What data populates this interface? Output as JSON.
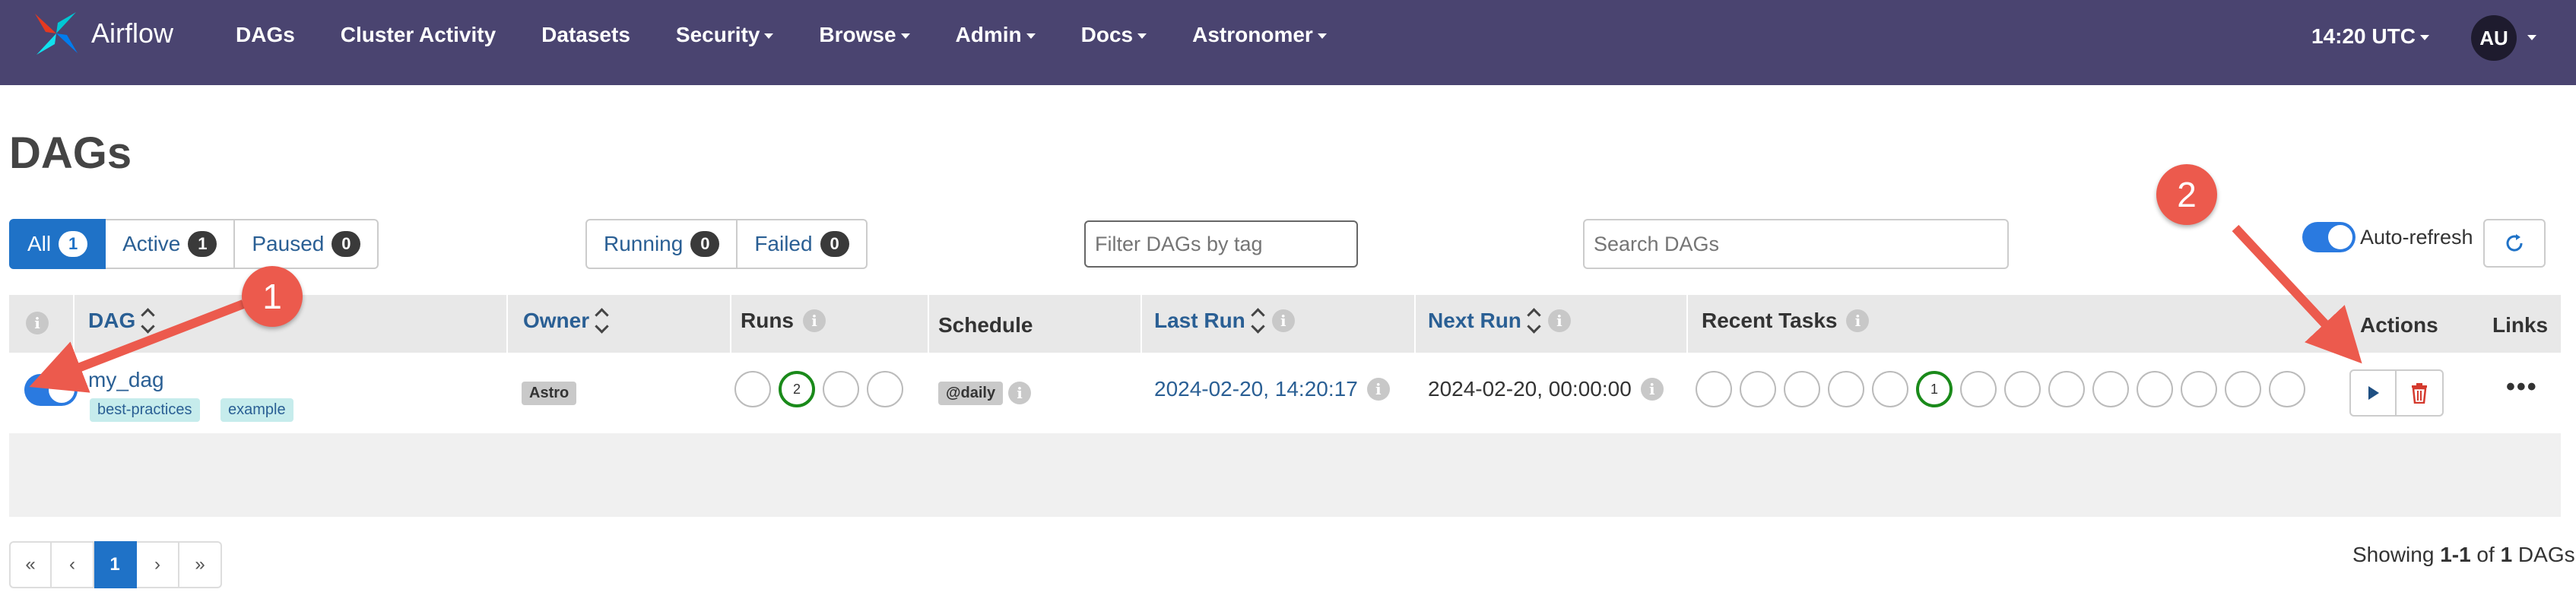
{
  "navbar": {
    "brand": "Airflow",
    "items": [
      {
        "label": "DAGs",
        "dropdown": false
      },
      {
        "label": "Cluster Activity",
        "dropdown": false
      },
      {
        "label": "Datasets",
        "dropdown": false
      },
      {
        "label": "Security",
        "dropdown": true
      },
      {
        "label": "Browse",
        "dropdown": true
      },
      {
        "label": "Admin",
        "dropdown": true
      },
      {
        "label": "Docs",
        "dropdown": true
      },
      {
        "label": "Astronomer",
        "dropdown": true
      }
    ],
    "time": "14:20 UTC",
    "user_initials": "AU"
  },
  "page": {
    "title": "DAGs"
  },
  "filters": {
    "status": [
      {
        "label": "All",
        "count": "1",
        "active": true
      },
      {
        "label": "Active",
        "count": "1",
        "active": false
      },
      {
        "label": "Paused",
        "count": "0",
        "active": false
      }
    ],
    "run_state": [
      {
        "label": "Running",
        "count": "0"
      },
      {
        "label": "Failed",
        "count": "0"
      }
    ],
    "tag_placeholder": "Filter DAGs by tag",
    "search_placeholder": "Search DAGs",
    "auto_refresh_label": "Auto-refresh"
  },
  "table": {
    "headers": {
      "dag": "DAG",
      "owner": "Owner",
      "runs": "Runs",
      "schedule": "Schedule",
      "last_run": "Last Run",
      "next_run": "Next Run",
      "recent_tasks": "Recent Tasks",
      "actions": "Actions",
      "links": "Links"
    },
    "rows": [
      {
        "dag_id": "my_dag",
        "tags": [
          "best-practices",
          "example"
        ],
        "owner": "Astro",
        "runs": [
          "",
          "2",
          "",
          ""
        ],
        "schedule": "@daily",
        "last_run": "2024-02-20, 14:20:17",
        "next_run": "2024-02-20, 00:00:00",
        "recent_tasks": [
          "",
          "",
          "",
          "",
          "",
          "1",
          "",
          "",
          "",
          "",
          "",
          "",
          "",
          ""
        ]
      }
    ]
  },
  "pagination": {
    "first": "«",
    "prev": "‹",
    "current": "1",
    "next": "›",
    "last": "»"
  },
  "showing": {
    "prefix": "Showing ",
    "range": "1-1",
    "of": " of ",
    "total": "1",
    "suffix": " DAGs"
  },
  "annotations": [
    "1",
    "2"
  ],
  "colors": {
    "navbar": "#4a4470",
    "primary": "#1f72c7",
    "annotation": "#ec5a4d",
    "success_ring": "#1a8a1a",
    "delete": "#d43a2e"
  }
}
